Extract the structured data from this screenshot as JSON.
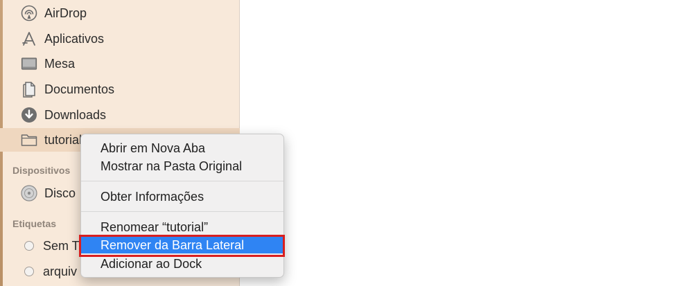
{
  "sidebar": {
    "favorites": [
      {
        "label": "AirDrop",
        "icon": "airdrop-icon"
      },
      {
        "label": "Aplicativos",
        "icon": "applications-icon"
      },
      {
        "label": "Mesa",
        "icon": "desktop-icon"
      },
      {
        "label": "Documentos",
        "icon": "documents-icon"
      },
      {
        "label": "Downloads",
        "icon": "downloads-icon"
      },
      {
        "label": "tutorial",
        "icon": "folder-icon",
        "selected": true
      }
    ],
    "devices_header": "Dispositivos",
    "devices": [
      {
        "label": "Disco",
        "icon": "disk-icon"
      }
    ],
    "tags_header": "Etiquetas",
    "tags": [
      {
        "label": "Sem T"
      },
      {
        "label": "arquiv"
      }
    ]
  },
  "context_menu": {
    "items": [
      {
        "label": "Abrir em Nova Aba"
      },
      {
        "label": "Mostrar na Pasta Original"
      },
      {
        "label": "Obter Informações"
      },
      {
        "label": "Renomear “tutorial”"
      },
      {
        "label": "Remover da Barra Lateral",
        "highlighted": true
      },
      {
        "label": "Adicionar ao Dock"
      }
    ]
  },
  "colors": {
    "sidebar_bg": "#f8e9da",
    "highlight": "#2f84f3",
    "annotation_box": "#d91f1f"
  }
}
